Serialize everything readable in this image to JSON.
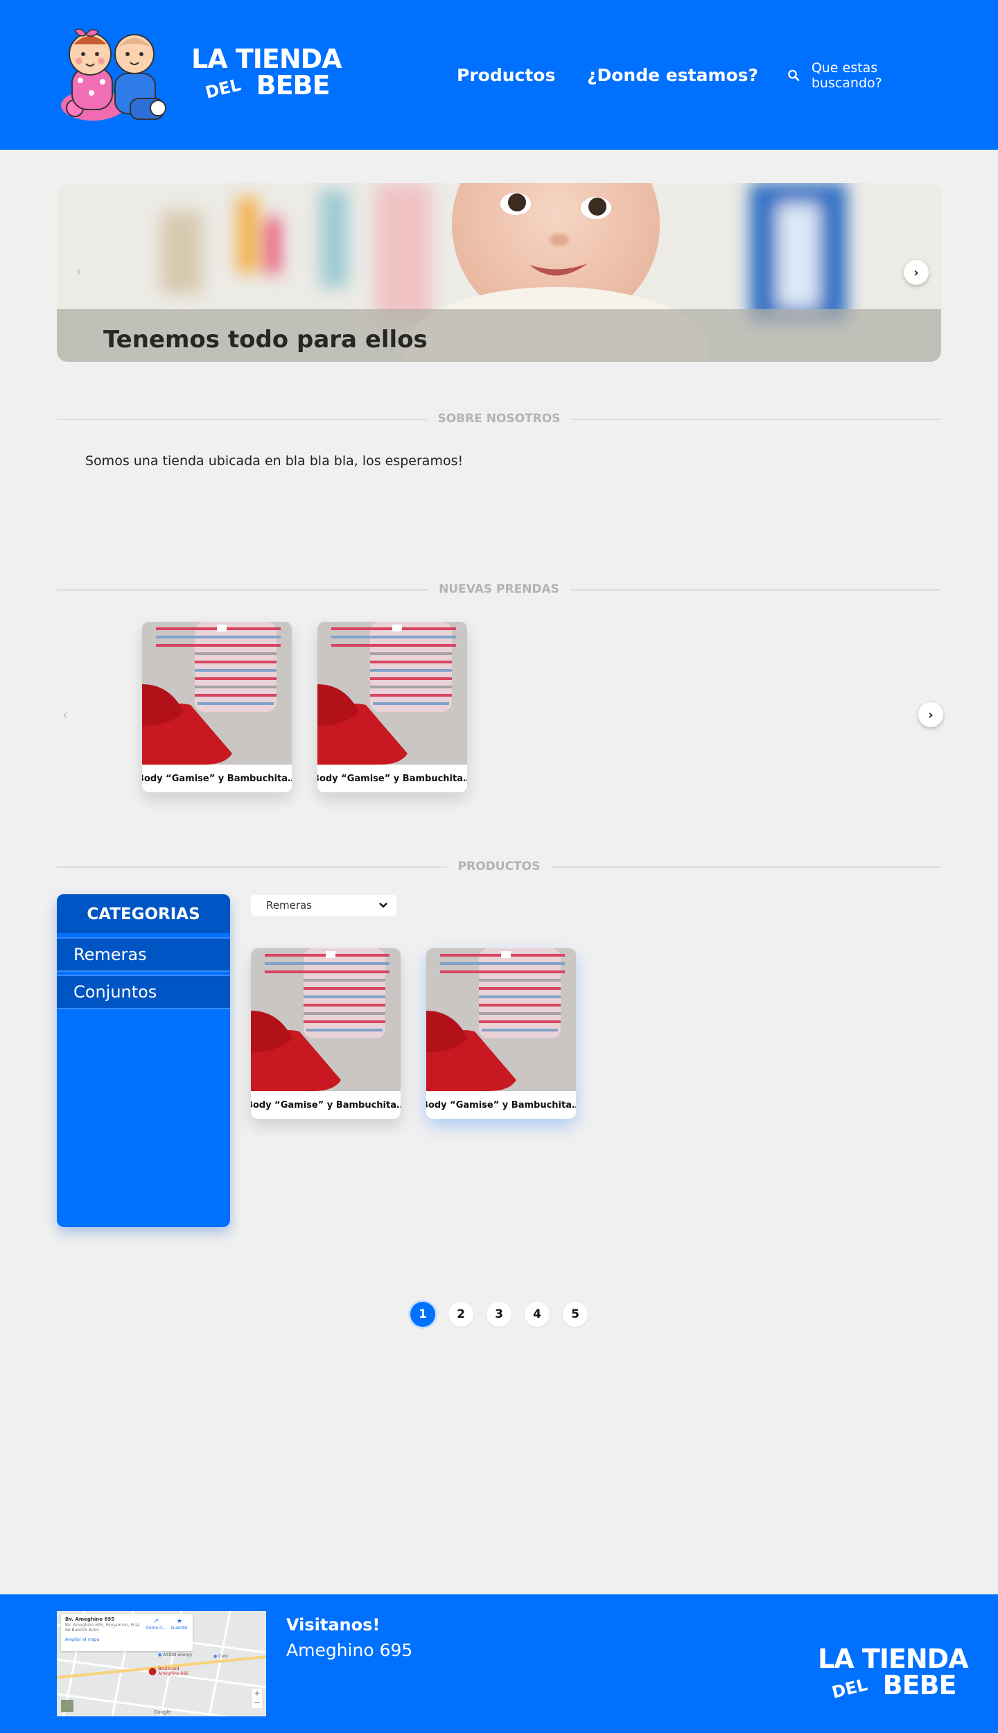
{
  "colors": {
    "brand_blue": "#0070ff",
    "dark_blue": "#0055c4",
    "page_bg": "#f0f0f0"
  },
  "header": {
    "brand_line1": "LA TIENDA",
    "brand_del": "DEL",
    "brand_bebe": "BEBE",
    "nav": [
      "Productos",
      "¿Donde estamos?"
    ],
    "search_placeholder": "Que estas buscando?",
    "search_icon": "search-icon"
  },
  "hero": {
    "caption": "Tenemos todo para ellos"
  },
  "about": {
    "heading": "SOBRE NOSOTROS",
    "text": "Somos una tienda ubicada en bla bla bla, los esperamos!"
  },
  "new_items": {
    "heading": "NUEVAS PRENDAS",
    "cards": [
      {
        "title": "Body “Gamise” y Bambuchita…"
      },
      {
        "title": "Body “Gamise” y Bambuchita…"
      }
    ]
  },
  "products": {
    "heading": "PRODUCTOS",
    "categories_title": "CATEGORIAS",
    "categories": [
      "Remeras",
      "Conjuntos"
    ],
    "filter_selected": "Remeras",
    "cards": [
      {
        "title": "Body “Gamise” y Bambuchita…"
      },
      {
        "title": "Body “Gamise” y Bambuchita…"
      }
    ],
    "pages": [
      "1",
      "2",
      "3",
      "4",
      "5"
    ],
    "current_page": "1"
  },
  "footer": {
    "visit_title": "Visitanos!",
    "visit_address": "Ameghino 695",
    "brand_line1": "LA TIENDA",
    "brand_del": "DEL",
    "brand_bebe": "BEBE",
    "map": {
      "place_name": "Bv. Ameghino 695",
      "place_address": "Bv. Ameghino 695, Pergamino, Pcia. de Buenos Aires",
      "directions_label": "Cómo ll...",
      "save_label": "Guardar",
      "enlarge_link": "Ampliar el mapa",
      "marker_label": "Boulevard Ameghino 695",
      "poi_1": "AXION energy",
      "poi_2": "Coto",
      "zoom_in": "+",
      "zoom_out": "−",
      "google_label": "Google"
    }
  }
}
